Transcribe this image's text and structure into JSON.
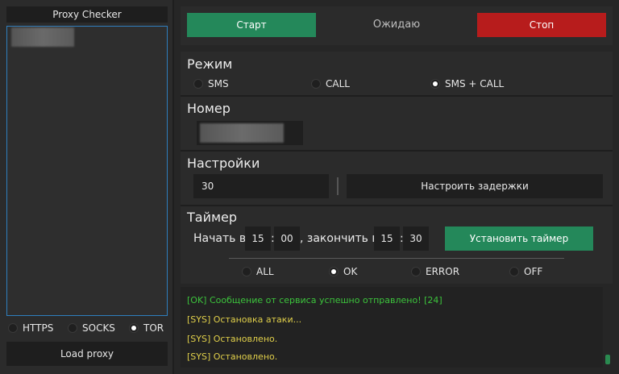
{
  "left": {
    "title": "Proxy Checker",
    "types": [
      {
        "label": "HTTPS",
        "selected": false
      },
      {
        "label": "SOCKS",
        "selected": false
      },
      {
        "label": "TOR",
        "selected": true
      }
    ],
    "load_label": "Load proxy"
  },
  "controls": {
    "start_label": "Старт",
    "status": "Ожидаю",
    "stop_label": "Стоп"
  },
  "mode": {
    "title": "Режим",
    "options": [
      {
        "label": "SMS",
        "selected": false
      },
      {
        "label": "CALL",
        "selected": false
      },
      {
        "label": "SMS + CALL",
        "selected": true
      }
    ]
  },
  "number": {
    "title": "Номер"
  },
  "settings": {
    "title": "Настройки",
    "value": "30",
    "delays_label": "Настроить задержки"
  },
  "timer": {
    "title": "Таймер",
    "start_text": "Начать в",
    "start_h": "15",
    "start_m": "00",
    "end_text": ", закончить в",
    "end_h": "15",
    "end_m": "30",
    "colon": ":",
    "set_label": "Установить таймер"
  },
  "filter": {
    "options": [
      {
        "label": "ALL",
        "selected": false
      },
      {
        "label": "OK",
        "selected": true
      },
      {
        "label": "ERROR",
        "selected": false
      },
      {
        "label": "OFF",
        "selected": false
      }
    ]
  },
  "log": [
    {
      "text": "[OK] Сообщение от сервиса успешно отправлено! [24]",
      "color": "#3cc43c"
    },
    {
      "text": "[SYS] Остановка атаки...",
      "color": "#e0cf4a"
    },
    {
      "text": "[SYS] Остановлено.",
      "color": "#e0cf4a"
    },
    {
      "text": "[SYS] Остановлено.",
      "color": "#e0cf4a"
    }
  ],
  "colors": {
    "accent_green": "#24885a",
    "stop_red": "#b71c1c",
    "list_border": "#2f7fbf"
  }
}
